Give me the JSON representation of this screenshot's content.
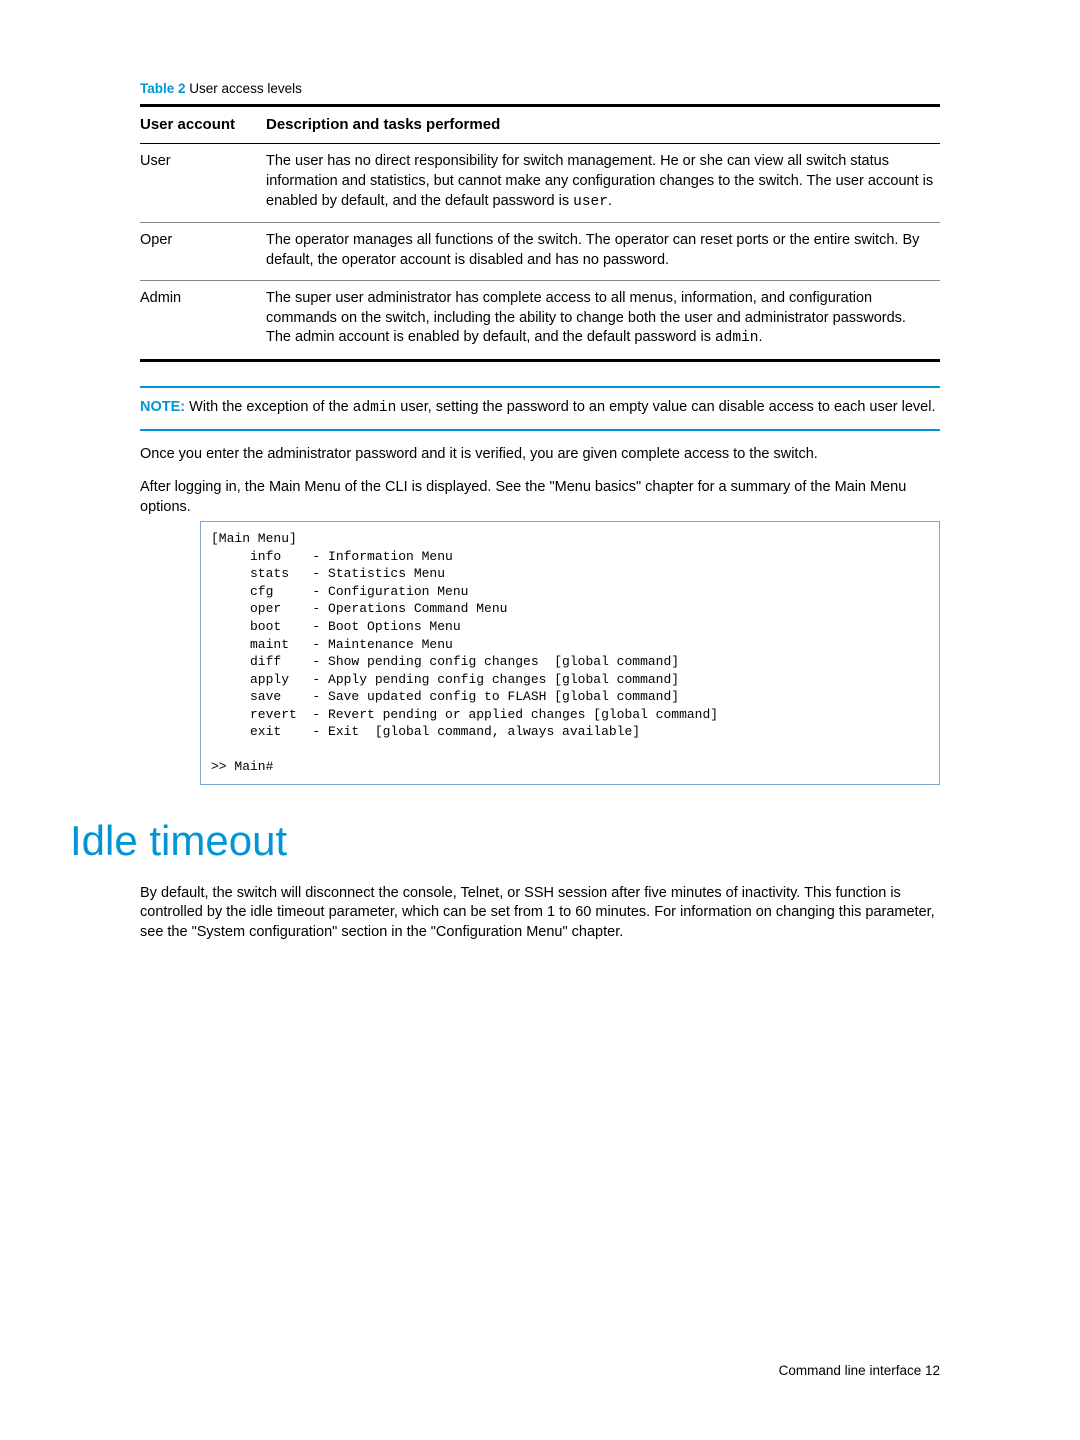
{
  "table": {
    "caption_label": "Table 2",
    "caption_text": "User access levels",
    "headers": {
      "col1": "User account",
      "col2": "Description and tasks performed"
    },
    "rows": {
      "r1": {
        "account": "User",
        "desc_prefix": "The user has no direct responsibility for switch management. He or she can view all switch status information and statistics, but cannot make any configuration changes to the switch. The user account is enabled by default, and the default password is ",
        "desc_code": "user",
        "desc_suffix": "."
      },
      "r2": {
        "account": "Oper",
        "desc": "The operator manages all functions of the switch. The operator can reset ports or the entire switch. By default, the operator account is disabled and has no password."
      },
      "r3": {
        "account": "Admin",
        "desc_prefix": "The super user administrator has complete access to all menus, information, and configuration commands on the switch, including the ability to change both the user and administrator passwords. The admin account is enabled by default, and the default password is ",
        "desc_code": "admin",
        "desc_suffix": "."
      }
    }
  },
  "note": {
    "label": "NOTE:",
    "prefix": "With the exception of the ",
    "code": "admin",
    "suffix": " user, setting the password to an empty value can disable access to each user level."
  },
  "para1": "Once you enter the administrator password and it is verified, you are given complete access to the switch.",
  "para2": "After logging in, the Main Menu of the CLI is displayed. See the \"Menu basics\" chapter for a summary of the Main Menu options.",
  "cli": "[Main Menu]\n     info    - Information Menu\n     stats   - Statistics Menu\n     cfg     - Configuration Menu\n     oper    - Operations Command Menu\n     boot    - Boot Options Menu\n     maint   - Maintenance Menu\n     diff    - Show pending config changes  [global command]\n     apply   - Apply pending config changes [global command]\n     save    - Save updated config to FLASH [global command]\n     revert  - Revert pending or applied changes [global command]\n     exit    - Exit  [global command, always available]\n\n>> Main#",
  "section_heading": "Idle timeout",
  "section_para": "By default, the switch will disconnect the console, Telnet, or SSH session after five minutes of inactivity. This function is controlled by the idle timeout parameter, which can be set from 1 to 60 minutes. For information on changing this parameter, see the \"System configuration\" section in the \"Configuration Menu\" chapter.",
  "footer": "Command line interface   12"
}
